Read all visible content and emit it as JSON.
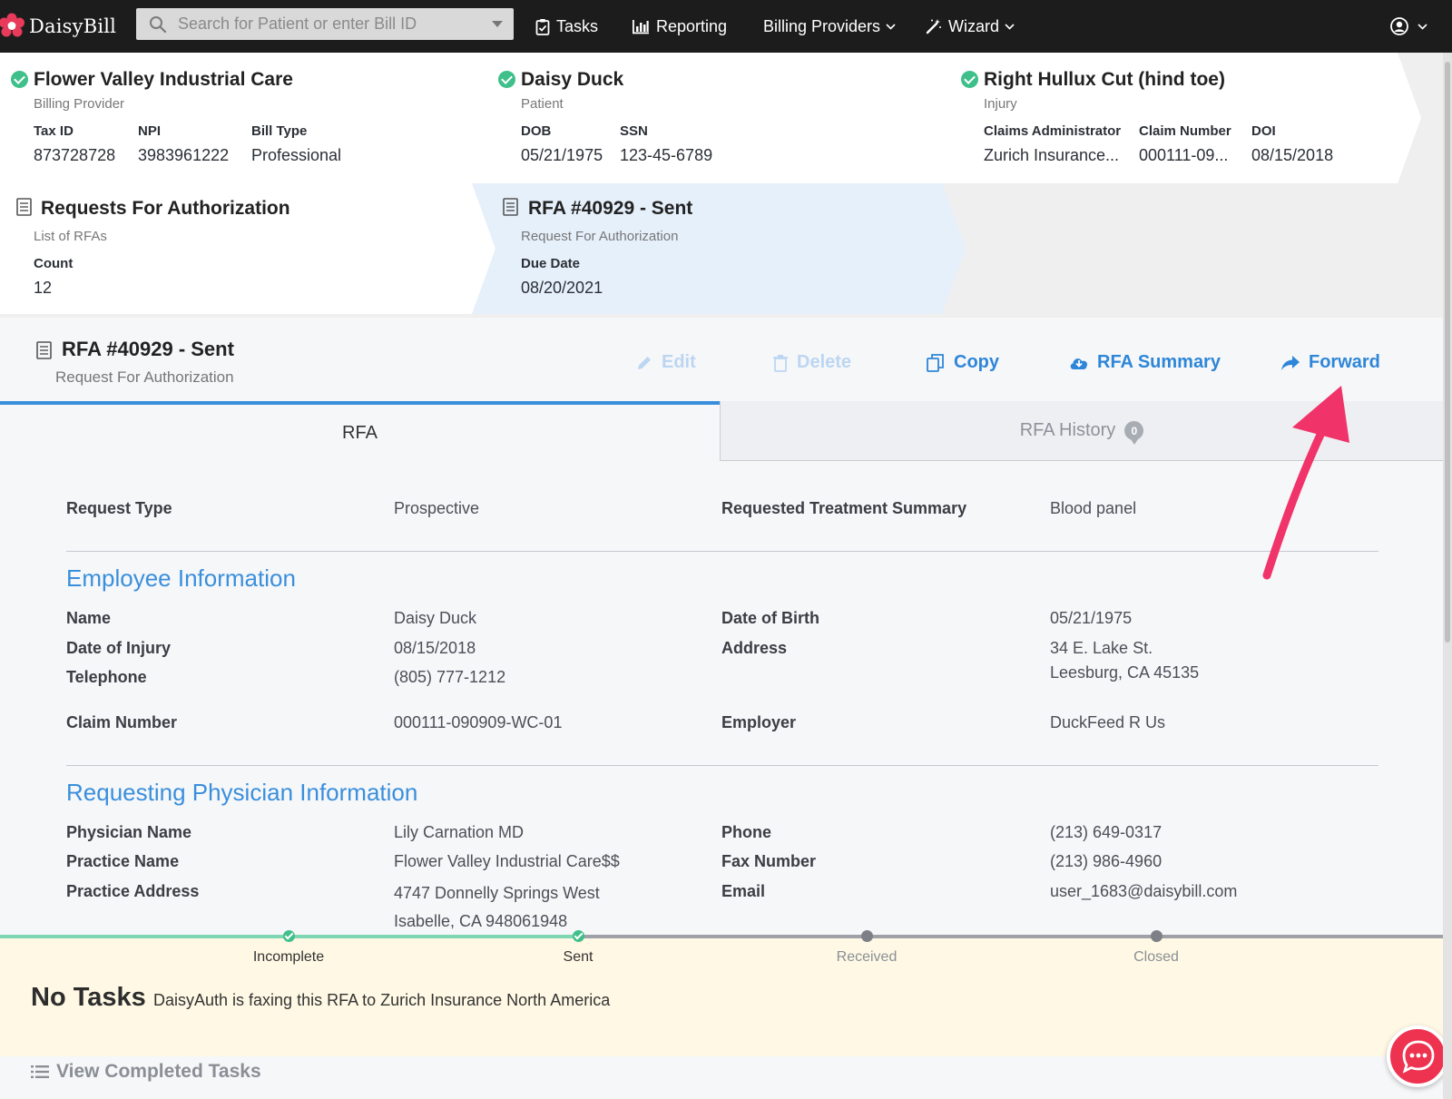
{
  "app": {
    "brand": "DaisyBill"
  },
  "search": {
    "placeholder": "Search for Patient or enter Bill ID"
  },
  "nav": {
    "tasks": "Tasks",
    "reporting": "Reporting",
    "billing_providers": "Billing Providers",
    "wizard": "Wizard"
  },
  "crumbs": {
    "provider": {
      "title": "Flower Valley Industrial Care",
      "subtitle": "Billing Provider",
      "fields": [
        {
          "label": "Tax ID",
          "value": "873728728"
        },
        {
          "label": "NPI",
          "value": "3983961222"
        },
        {
          "label": "Bill Type",
          "value": "Professional"
        }
      ]
    },
    "patient": {
      "title": "Daisy Duck",
      "subtitle": "Patient",
      "fields": [
        {
          "label": "DOB",
          "value": "05/21/1975"
        },
        {
          "label": "SSN",
          "value": "123-45-6789"
        }
      ]
    },
    "injury": {
      "title": "Right Hullux Cut (hind toe)",
      "subtitle": "Injury",
      "fields": [
        {
          "label": "Claims Administrator",
          "value": "Zurich Insurance..."
        },
        {
          "label": "Claim Number",
          "value": "000111-09..."
        },
        {
          "label": "DOI",
          "value": "08/15/2018"
        }
      ]
    },
    "rfas": {
      "title": "Requests For Authorization",
      "subtitle": "List of RFAs",
      "count_label": "Count",
      "count_value": "12"
    },
    "rfa": {
      "title": "RFA #40929 - Sent",
      "subtitle": "Request For Authorization",
      "due_label": "Due Date",
      "due_value": "08/20/2021"
    }
  },
  "header": {
    "title": "RFA #40929 - Sent",
    "subtitle": "Request For Authorization"
  },
  "actions": {
    "edit": "Edit",
    "delete": "Delete",
    "copy": "Copy",
    "summary": "RFA Summary",
    "forward": "Forward"
  },
  "tabs": {
    "rfa": "RFA",
    "history": "RFA History",
    "history_count": "0"
  },
  "details": {
    "request_type_label": "Request Type",
    "request_type": "Prospective",
    "treatment_label": "Requested Treatment Summary",
    "treatment": "Blood panel",
    "employee_heading": "Employee Information",
    "employee": {
      "name_label": "Name",
      "name": "Daisy Duck",
      "dob_label": "Date of Birth",
      "dob": "05/21/1975",
      "doi_label": "Date of Injury",
      "doi": "08/15/2018",
      "address_label": "Address",
      "address_1": "34 E. Lake St.",
      "address_2": "Leesburg, CA 45135",
      "phone_label": "Telephone",
      "phone": "(805) 777-1212",
      "claim_label": "Claim Number",
      "claim": "000111-090909-WC-01",
      "employer_label": "Employer",
      "employer": "DuckFeed R Us"
    },
    "physician_heading": "Requesting Physician Information",
    "physician": {
      "name_label": "Physician Name",
      "name": "Lily Carnation MD",
      "phone_label": "Phone",
      "phone": "(213) 649-0317",
      "practice_label": "Practice Name",
      "practice": "Flower Valley Industrial Care$$",
      "fax_label": "Fax Number",
      "fax": "(213) 986-4960",
      "address_label": "Practice Address",
      "address_1": "4747 Donnelly Springs West",
      "address_2": "Isabelle, CA 948061948",
      "email_label": "Email",
      "email": "user_1683@daisybill.com"
    }
  },
  "status_steps": [
    "Incomplete",
    "Sent",
    "Received",
    "Closed"
  ],
  "tasks": {
    "heading": "No Tasks",
    "note": "DaisyAuth is faxing this RFA to Zurich Insurance North America",
    "view_completed": "View Completed Tasks"
  },
  "colors": {
    "accent": "#3a8fdc",
    "success": "#3fbf8a",
    "annotation_arrow": "#f0346a",
    "chat": "#ee3350"
  }
}
